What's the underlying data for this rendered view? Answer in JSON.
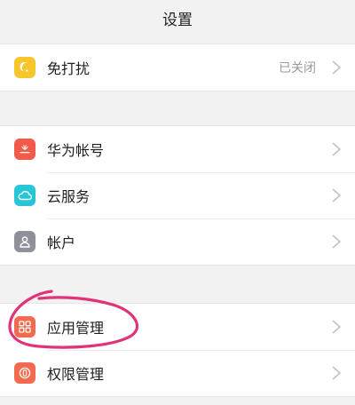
{
  "header": {
    "title": "设置"
  },
  "groups": [
    {
      "items": [
        {
          "label": "免打扰",
          "value": "已关闭",
          "icon": "moon-icon",
          "color": "#F7C52C"
        }
      ]
    },
    {
      "items": [
        {
          "label": "华为帐号",
          "icon": "huawei-logo-icon",
          "color": "#F35A4A"
        },
        {
          "label": "云服务",
          "icon": "cloud-icon",
          "color": "#26C6D6"
        },
        {
          "label": "帐户",
          "icon": "person-icon",
          "color": "#8E9199"
        }
      ]
    },
    {
      "items": [
        {
          "label": "应用管理",
          "icon": "grid-icon",
          "color": "#F36A4F"
        },
        {
          "label": "权限管理",
          "icon": "permission-icon",
          "color": "#F36A4F"
        }
      ]
    }
  ],
  "annotation": {
    "color": "#E0337A"
  }
}
